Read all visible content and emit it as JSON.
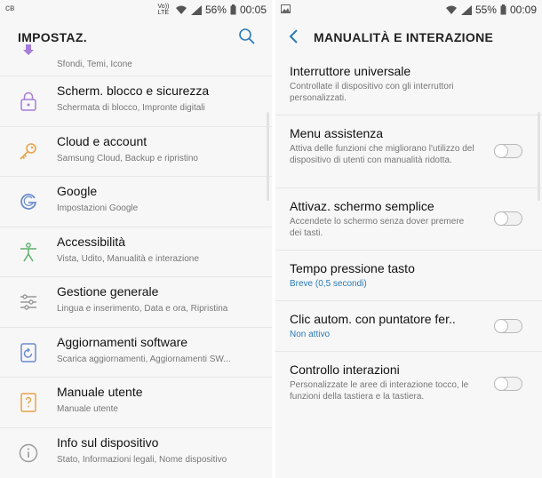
{
  "left": {
    "status": {
      "carrier_mark": "ᴄʙ",
      "lte": "Vo)) LTE",
      "battery": "56%",
      "time": "00:05"
    },
    "title": "IMPOSTAZ.",
    "partial_sub": "Sfondi, Temi, Icone",
    "items": [
      {
        "title": "Scherm. blocco e sicurezza",
        "subtitle": "Schermata di blocco, Impronte digitali",
        "icon": "lock-icon"
      },
      {
        "title": "Cloud e account",
        "subtitle": "Samsung Cloud, Backup e ripristino",
        "icon": "key-icon"
      },
      {
        "title": "Google",
        "subtitle": "Impostazioni Google",
        "icon": "google-icon"
      },
      {
        "title": "Accessibilità",
        "subtitle": "Vista, Udito, Manualità e interazione",
        "icon": "accessibility-icon"
      },
      {
        "title": "Gestione generale",
        "subtitle": "Lingua e inserimento, Data e ora, Ripristina",
        "icon": "sliders-icon"
      },
      {
        "title": "Aggiornamenti software",
        "subtitle": "Scarica aggiornamenti, Aggiornamenti SW...",
        "icon": "software-update-icon"
      },
      {
        "title": "Manuale utente",
        "subtitle": "Manuale utente",
        "icon": "manual-icon"
      },
      {
        "title": "Info sul dispositivo",
        "subtitle": "Stato, Informazioni legali, Nome dispositivo",
        "icon": "info-icon"
      }
    ]
  },
  "right": {
    "status": {
      "battery": "55%",
      "time": "00:09"
    },
    "title": "MANUALITÀ E INTERAZIONE",
    "items": [
      {
        "title": "Interruttore universale",
        "subtitle": "Controllate il dispositivo con gli interruttori personalizzati.",
        "toggle": null
      },
      {
        "title": "Menu assistenza",
        "subtitle": "Attiva delle funzioni che migliorano l'utilizzo del dispositivo di utenti con manualità ridotta.",
        "toggle": "off"
      },
      {
        "title": "Attivaz. schermo semplice",
        "subtitle": "Accendete lo schermo senza dover premere dei tasti.",
        "toggle": "off"
      },
      {
        "title": "Tempo pressione tasto",
        "subtitle": "Breve (0,5 secondi)",
        "accent": true,
        "toggle": null
      },
      {
        "title": "Clic autom. con puntatore fer..",
        "subtitle": "Non attivo",
        "accent": true,
        "toggle": "off"
      },
      {
        "title": "Controllo interazioni",
        "subtitle": "Personalizzate le aree di interazione tocco, le funzioni della tastiera e la tastiera.",
        "toggle": "off"
      }
    ]
  },
  "colors": {
    "accent": "#2a7bb5",
    "icon_blue": "#6a8ccf",
    "icon_orange": "#e8a24a",
    "icon_green": "#5bb06a",
    "icon_purple": "#a67dd8"
  }
}
